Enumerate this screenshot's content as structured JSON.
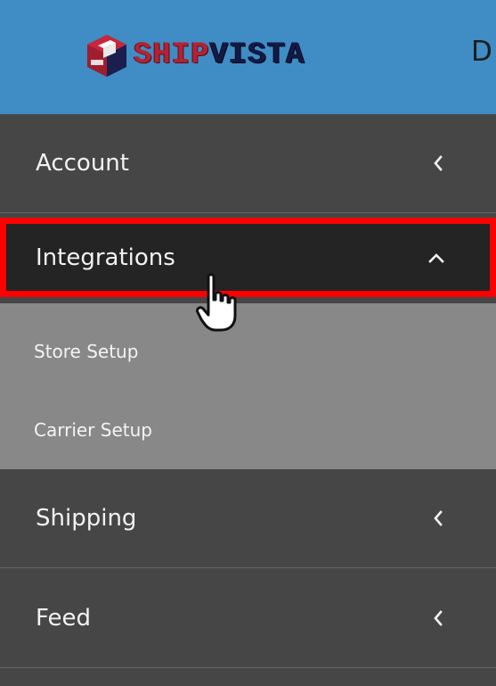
{
  "header": {
    "logo_part1": "SHIP",
    "logo_part2": "VISTA",
    "logo_icon": "cube-box-icon",
    "trailing_text": "D"
  },
  "sidebar": {
    "items": [
      {
        "label": "Account",
        "icon": "chevron-left-icon",
        "expanded": false
      },
      {
        "label": "Integrations",
        "icon": "chevron-up-icon",
        "expanded": true,
        "children": [
          {
            "label": "Store Setup"
          },
          {
            "label": "Carrier Setup"
          }
        ]
      },
      {
        "label": "Shipping",
        "icon": "chevron-left-icon",
        "expanded": false
      },
      {
        "label": "Feed",
        "icon": "chevron-left-icon",
        "expanded": false
      }
    ]
  },
  "colors": {
    "header_bg": "#3f8dc4",
    "sidebar_bg": "#464646",
    "active_bg": "#242424",
    "submenu_bg": "#888888",
    "highlight": "#ff0000",
    "logo_red": "#b52233",
    "logo_navy": "#141a45"
  }
}
